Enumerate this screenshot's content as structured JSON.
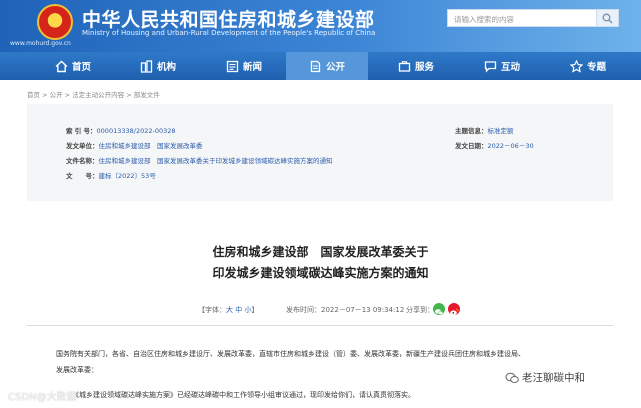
{
  "header": {
    "title": "中华人民共和国住房和城乡建设部",
    "subtitle": "Ministry of Housing and Urban-Rural Development of the People's Republic of China",
    "url": "www.mohurd.gov.cn",
    "search_placeholder": "请输入搜索的内容",
    "brand_color": "#1f63b8"
  },
  "nav": {
    "items": [
      {
        "label": "首页",
        "icon": "home-icon"
      },
      {
        "label": "机构",
        "icon": "building-icon"
      },
      {
        "label": "新闻",
        "icon": "news-icon"
      },
      {
        "label": "公开",
        "icon": "document-icon",
        "active": true
      },
      {
        "label": "服务",
        "icon": "service-icon"
      },
      {
        "label": "互动",
        "icon": "chat-icon"
      },
      {
        "label": "专题",
        "icon": "topic-icon"
      }
    ]
  },
  "breadcrumb": "首页 > 公开 > 法定主动公开内容 > 部发文件",
  "metadata": {
    "index_label": "索 引 号：",
    "index_value": "000013338/2022-00328",
    "issuer_label": "发文单位：",
    "issuer_value": "住房和城乡建设部　国家发展改革委",
    "doc_name_label": "文件名称：",
    "doc_name_value": "住房和城乡建设部　国家发展改革委关于印发城乡建设领域碳达峰实施方案的通知",
    "doc_no_label": "文　　号：",
    "doc_no_value": "建标〔2022〕53号",
    "category_label": "主题信息：",
    "category_value": "标准定额",
    "date_label": "发文日期：",
    "date_value": "2022－06－30"
  },
  "article": {
    "title_line1": "住房和城乡建设部　国家发展改革委关于",
    "title_line2": "印发城乡建设领域碳达峰实施方案的通知",
    "font_size_label": "【字体：",
    "font_size_options": "大 中 小",
    "font_size_close": "】",
    "publish_time": "发布时间：2022－07－13 09:34:12",
    "share_label": "分享到：",
    "body_line1": "国务院有关部门，各省、自治区住房和城乡建设厅、发展改革委，直辖市住房和城乡建设（管）委、发展改革委，新疆生产建设兵团住房和城乡建设局、",
    "body_line2": "发展改革委：",
    "body_line3": "《城乡建设领域碳达峰实施方案》已经碳达峰碳中和工作领导小组审议通过，现印发给你们，请认真贯彻落实。"
  },
  "watermarks": {
    "left": "CSDN@大数据",
    "right": "老汪聊碳中和"
  }
}
